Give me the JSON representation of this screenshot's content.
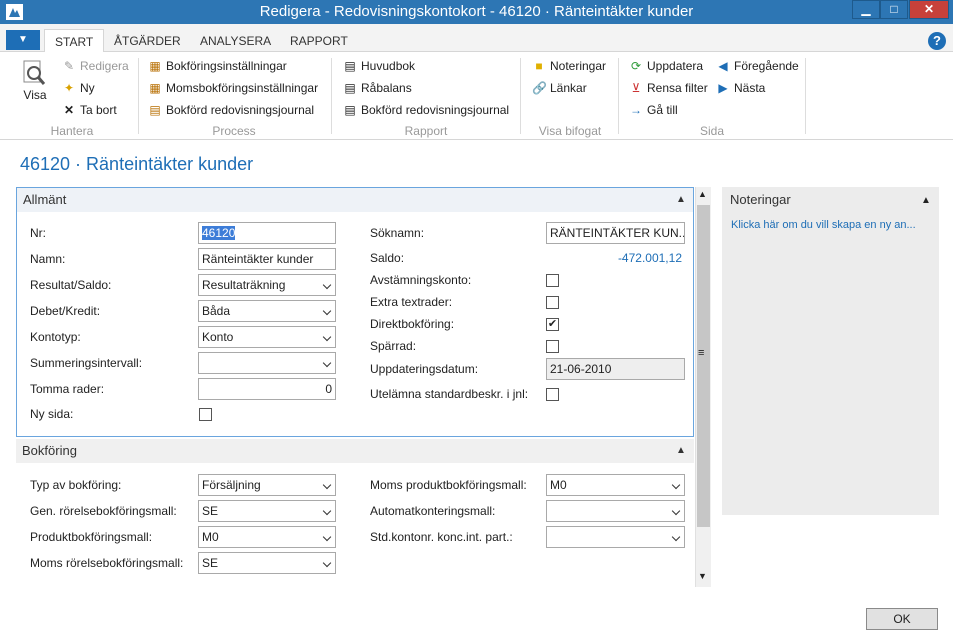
{
  "window": {
    "title": "Redigera - Redovisningskontokort - 46120 · Ränteintäkter kunder"
  },
  "tabs": [
    "START",
    "ÅTGÄRDER",
    "ANALYSERA",
    "RAPPORT"
  ],
  "ribbon": {
    "hantera": {
      "group": "Hantera",
      "visa": "Visa",
      "redigera": "Redigera",
      "ny": "Ny",
      "tabort": "Ta bort"
    },
    "process": {
      "group": "Process",
      "b1": "Bokföringsinställningar",
      "b2": "Momsbokföringsinställningar",
      "b3": "Bokförd redovisningsjournal"
    },
    "rapport": {
      "group": "Rapport",
      "b1": "Huvudbok",
      "b2": "Råbalans",
      "b3": "Bokförd redovisningsjournal"
    },
    "bifogat": {
      "group": "Visa bifogat",
      "b1": "Noteringar",
      "b2": "Länkar"
    },
    "sida": {
      "group": "Sida",
      "uppdatera": "Uppdatera",
      "rensa": "Rensa filter",
      "gatill": "Gå till",
      "foregaende": "Föregående",
      "nasta": "Nästa"
    }
  },
  "page_title": "46120 · Ränteintäkter kunder",
  "allmant": {
    "header": "Allmänt",
    "nr_label": "Nr:",
    "nr_value": "46120",
    "namn_label": "Namn:",
    "namn_value": "Ränteintäkter kunder",
    "resultat_label": "Resultat/Saldo:",
    "resultat_value": "Resultaträkning",
    "debet_label": "Debet/Kredit:",
    "debet_value": "Båda",
    "kontotyp_label": "Kontotyp:",
    "kontotyp_value": "Konto",
    "summering_label": "Summeringsintervall:",
    "summering_value": "",
    "tomma_label": "Tomma rader:",
    "tomma_value": "0",
    "nysida_label": "Ny sida:",
    "soknamn_label": "Söknamn:",
    "soknamn_value": "RÄNTEINTÄKTER KUN...",
    "saldo_label": "Saldo:",
    "saldo_value": "-472.001,12",
    "avstamning_label": "Avstämningskonto:",
    "extra_label": "Extra textrader:",
    "direkt_label": "Direktbokföring:",
    "sparrad_label": "Spärrad:",
    "uppdatering_label": "Uppdateringsdatum:",
    "uppdatering_value": "21-06-2010",
    "utelamna_label": "Utelämna standardbeskr. i jnl:"
  },
  "bokforing": {
    "header": "Bokföring",
    "typ_label": "Typ av bokföring:",
    "typ_value": "Försäljning",
    "gen_label": "Gen. rörelsebokföringsmall:",
    "gen_value": "SE",
    "produkt_label": "Produktbokföringsmall:",
    "produkt_value": "M0",
    "moms_rorelse_label": "Moms rörelsebokföringsmall:",
    "moms_rorelse_value": "SE",
    "moms_produkt_label": "Moms produktbokföringsmall:",
    "moms_produkt_value": "M0",
    "auto_label": "Automatkonteringsmall:",
    "auto_value": "",
    "std_label": "Std.kontonr. konc.int. part.:",
    "std_value": ""
  },
  "notes": {
    "header": "Noteringar",
    "link": "Klicka här om du vill skapa en ny an..."
  },
  "ok": "OK",
  "colors": {
    "accent": "#1e6eb6",
    "titlebar": "#2d76b4"
  }
}
